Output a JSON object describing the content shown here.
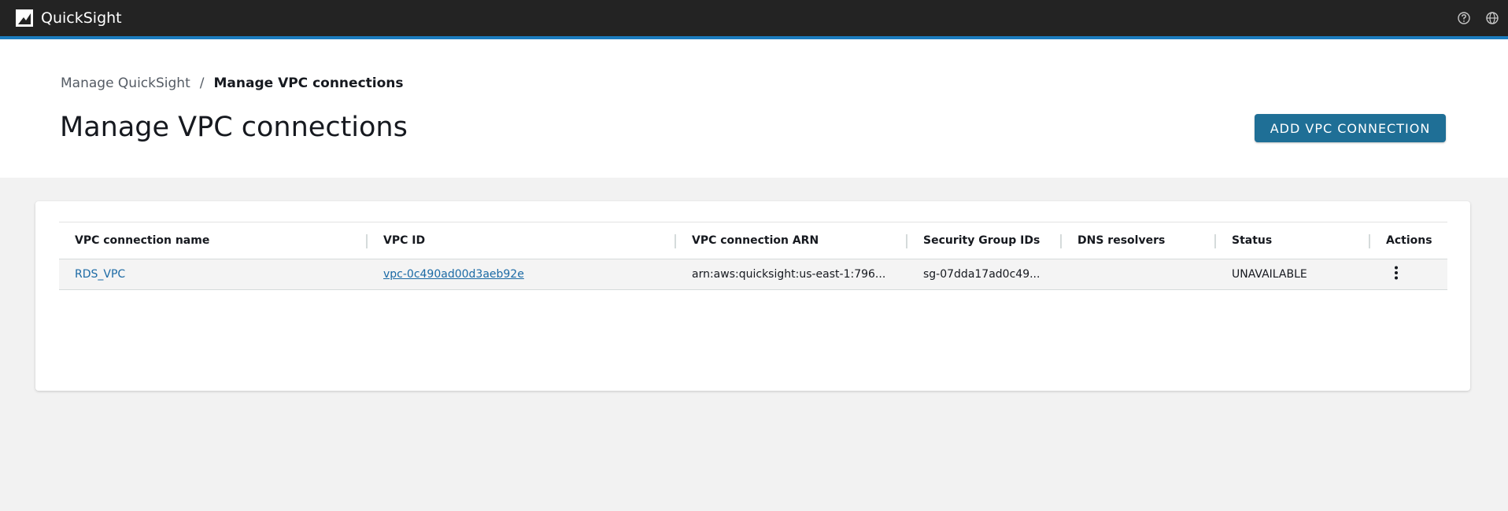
{
  "app": {
    "name": "QuickSight",
    "icons": [
      "quicksight-logo-icon",
      "help-icon",
      "globe-icon"
    ]
  },
  "breadcrumb": {
    "parent": "Manage QuickSight",
    "separator": "/",
    "current": "Manage VPC connections"
  },
  "page": {
    "title": "Manage VPC connections",
    "add_button_label": "ADD VPC CONNECTION"
  },
  "table": {
    "columns": [
      "VPC connection name",
      "VPC ID",
      "VPC connection ARN",
      "Security Group IDs",
      "DNS resolvers",
      "Status",
      "Actions"
    ],
    "rows": [
      {
        "name": "RDS_VPC",
        "vpc_id": "vpc-0c490ad00d3aeb92e",
        "arn": "arn:aws:quicksight:us-east-1:796...",
        "security_group_ids": "sg-07dda17ad0c49...",
        "dns_resolvers": "",
        "status": "UNAVAILABLE",
        "actions_icon": "more-vertical-icon"
      }
    ]
  },
  "colors": {
    "topbar": "#232323",
    "accent": "#1b7cbf",
    "primary_button": "#1f6f96",
    "link": "#1b6aa5"
  }
}
